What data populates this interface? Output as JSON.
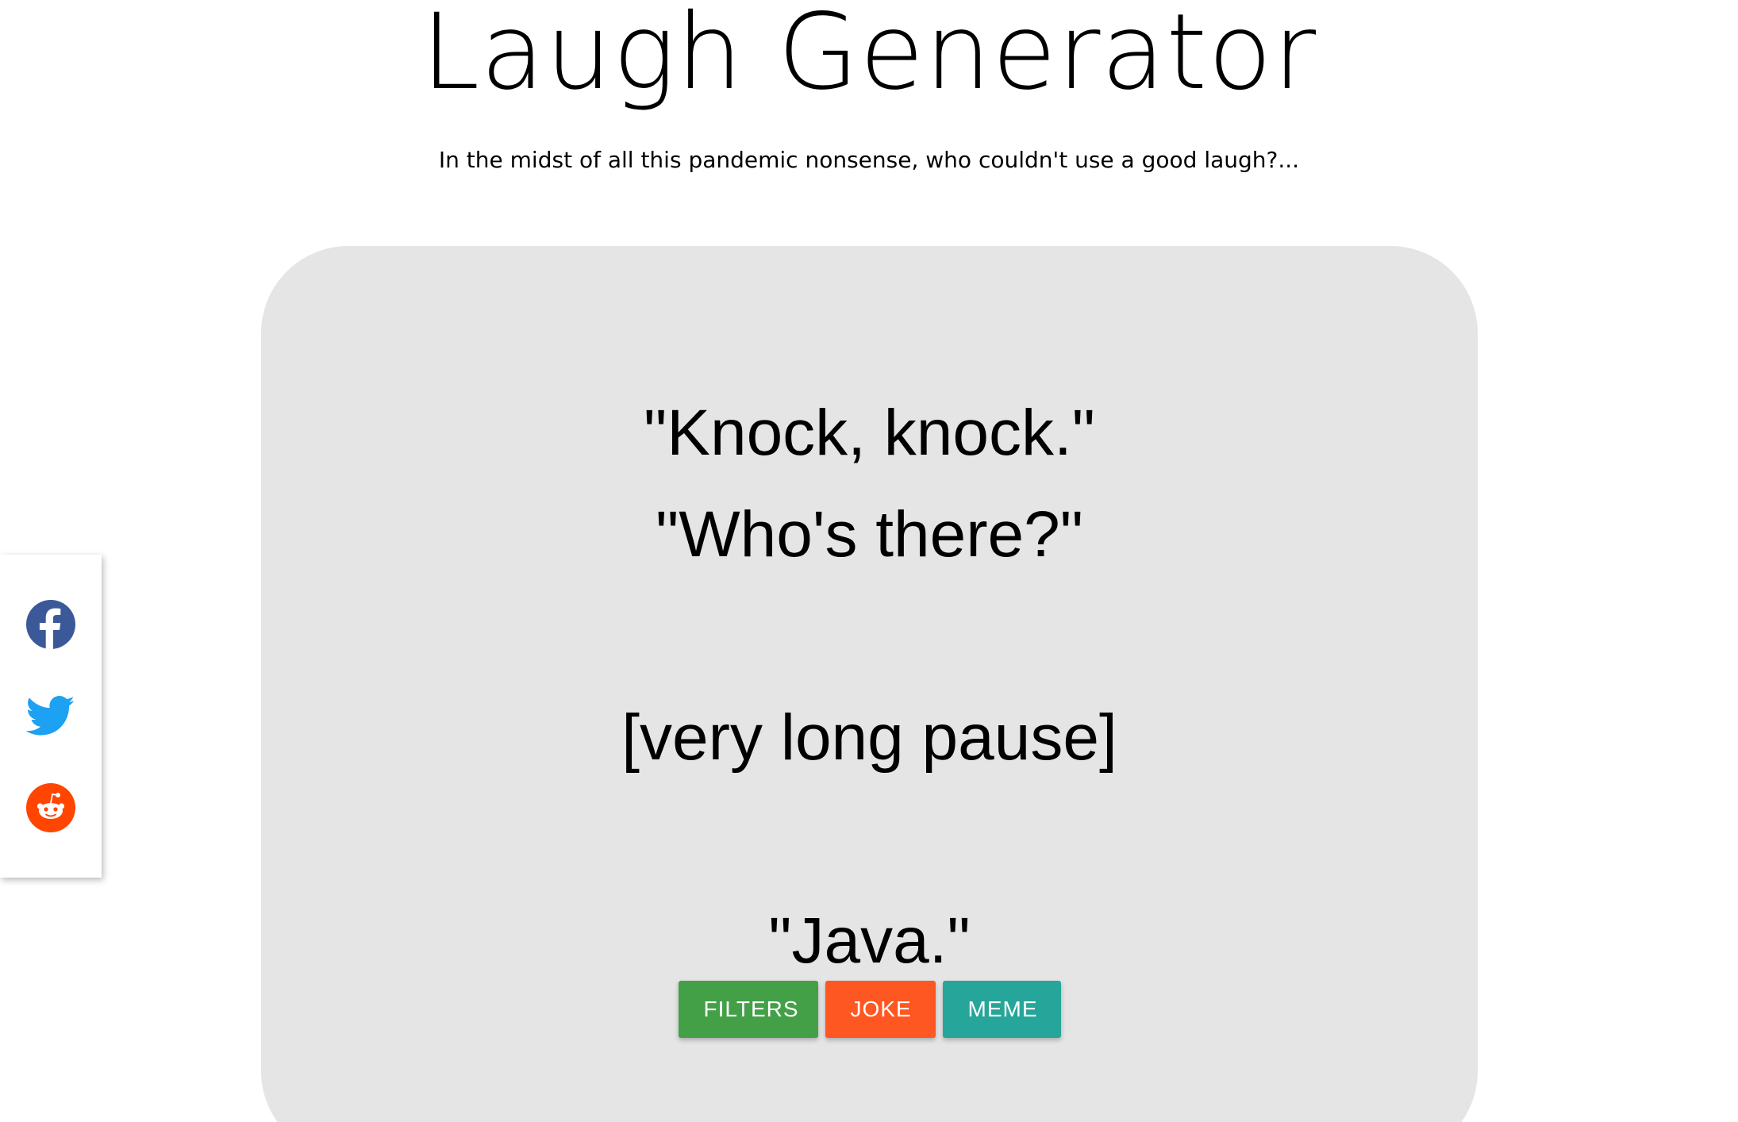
{
  "header": {
    "title": "Laugh Generator",
    "subtitle": "In the midst of all this pandemic nonsense, who couldn't use a good laugh?..."
  },
  "joke": {
    "lines": [
      "\"Knock, knock.\"",
      "\"Who's there?\"",
      "",
      "[very long pause]",
      "",
      "\"Java.\""
    ]
  },
  "buttons": {
    "filters_label": "FILTERS",
    "joke_label": "JOKE",
    "meme_label": "MEME"
  },
  "share": {
    "items": [
      {
        "icon": "facebook-icon",
        "color": "#3b5998"
      },
      {
        "icon": "twitter-icon",
        "color": "#1da1f2"
      },
      {
        "icon": "reddit-icon",
        "color": "#ff4500"
      }
    ]
  },
  "colors": {
    "filters": "#43a047",
    "joke": "#ff5722",
    "meme": "#26a69a",
    "card": "#e5e5e5"
  }
}
